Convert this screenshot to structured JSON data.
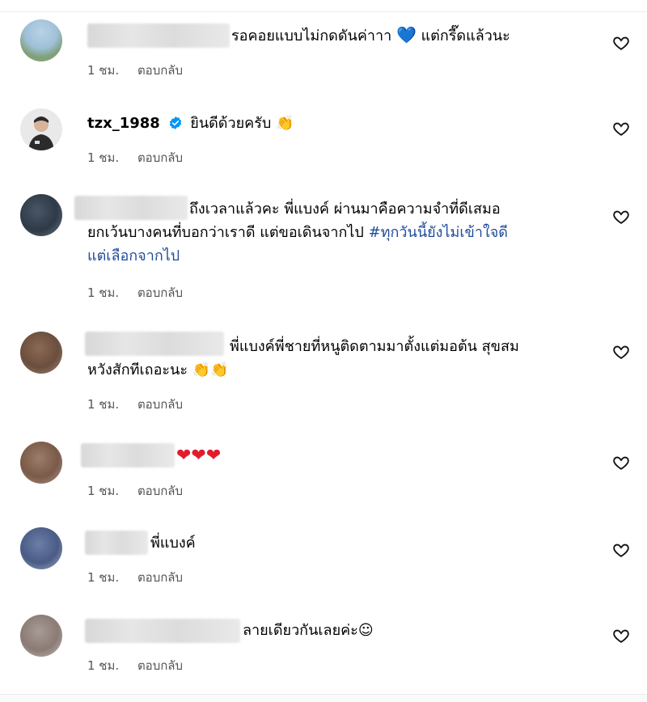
{
  "comments": [
    {
      "username": "",
      "text": "รอคอยแบบไม่กดดันค่าาา",
      "emoji1": "💙",
      "text2": "แต่กรี๊ดแล้วนะ",
      "time": "1 ชม.",
      "reply": "ตอบกลับ"
    },
    {
      "username": "tzx_1988",
      "text": "ยินดีด้วยครับ",
      "emoji1": "👏",
      "time": "1 ชม.",
      "reply": "ตอบกลับ"
    },
    {
      "username": "",
      "line1": "ถึงเวลาแล้วคะ พี่แบงค์ ผ่านมาคือความจำที่ดีเสมอ",
      "line2a": "ยกเว้นบางคนที่บอกว่าเราดี แต่ขอเดินจากไป",
      "hashtag1": "#ทุกวันนี้ยังไม่เข้าใจดี",
      "hashtag2": "แต่เลือกจากไป",
      "time": "1 ชม.",
      "reply": "ตอบกลับ"
    },
    {
      "username": "",
      "line1": "พี่แบงค์พี่ชายที่หนูติดตามมาตั้งแต่มอต้น สุขสม",
      "line2": "หวังสักทีเถอะนะ",
      "emoji1": "👏👏",
      "time": "1 ชม.",
      "reply": "ตอบกลับ"
    },
    {
      "username": "",
      "emoji1": "❤❤❤",
      "time": "1 ชม.",
      "reply": "ตอบกลับ"
    },
    {
      "username": "",
      "text": "พี่แบงค์",
      "time": "1 ชม.",
      "reply": "ตอบกลับ"
    },
    {
      "username": "",
      "text": "ลายเดียวกันเลยค่ะ☺",
      "time": "1 ชม.",
      "reply": "ตอบกลับ"
    }
  ],
  "icons": {
    "like": "heart-outline-icon",
    "verified": "verified-badge-icon"
  },
  "colors": {
    "hashtag": "#1e4b9c",
    "verified": "#0095f6",
    "red_heart": "#e11d2b",
    "blue_heart": "#1a5fd1"
  }
}
